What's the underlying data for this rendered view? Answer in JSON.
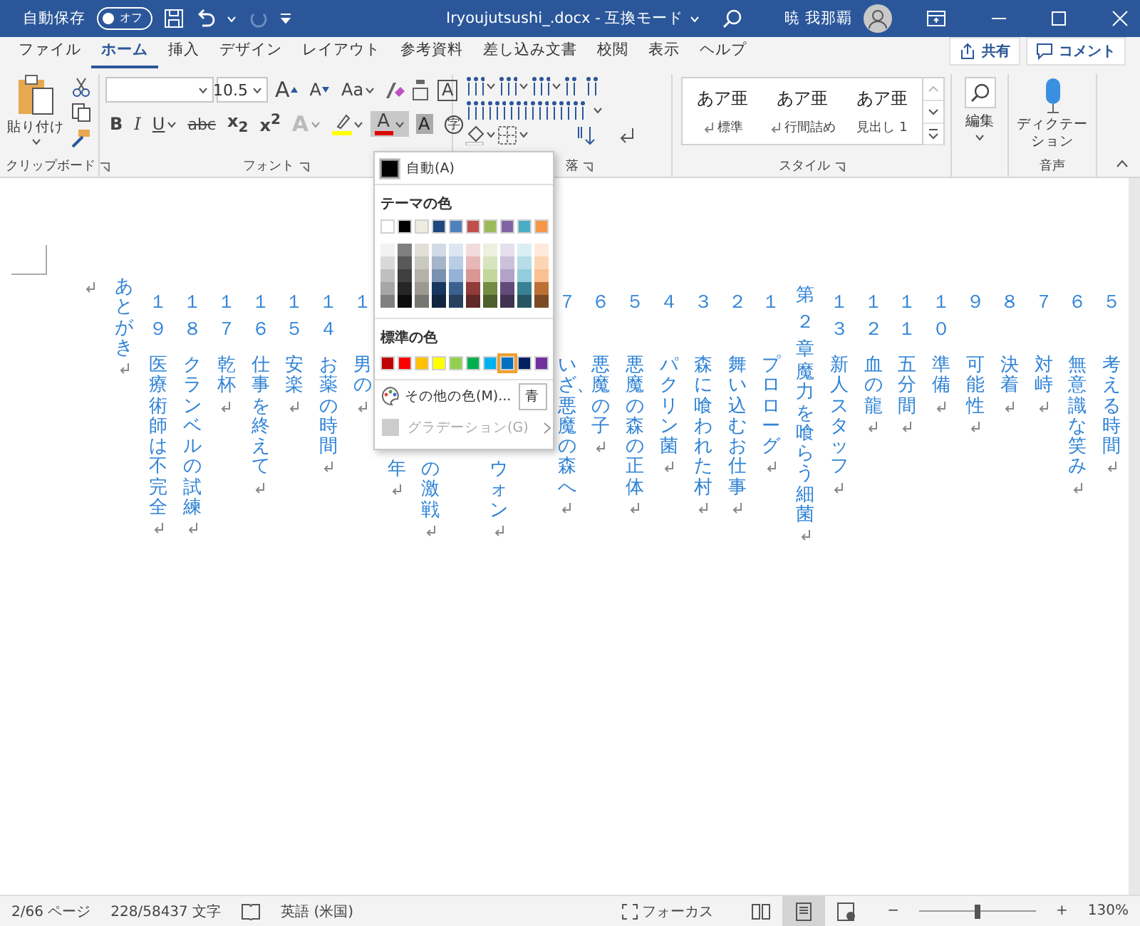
{
  "title_bar": {
    "autosave_label": "自動保存",
    "autosave_toggle": {
      "label": "オフ",
      "on": false
    },
    "document_title": "Iryoujutsushi_.docx  -  互換モード",
    "user_name": "暁 我那覇"
  },
  "tabs": [
    {
      "label": "ファイル",
      "selected": false
    },
    {
      "label": "ホーム",
      "selected": true
    },
    {
      "label": "挿入",
      "selected": false
    },
    {
      "label": "デザイン",
      "selected": false
    },
    {
      "label": "レイアウト",
      "selected": false
    },
    {
      "label": "参考資料",
      "selected": false
    },
    {
      "label": "差し込み文書",
      "selected": false
    },
    {
      "label": "校閲",
      "selected": false
    },
    {
      "label": "表示",
      "selected": false
    },
    {
      "label": "ヘルプ",
      "selected": false
    }
  ],
  "share_button": "共有",
  "comment_button": "コメント",
  "ribbon": {
    "clipboard": {
      "paste_label": "貼り付け",
      "group_label": "クリップボード"
    },
    "font": {
      "font_size": "10.5",
      "group_label": "フォント",
      "row_1": [
        {
          "kind": "grow",
          "label": "A"
        },
        {
          "kind": "shrink",
          "label": "A"
        },
        {
          "kind": "case",
          "label": "Aa"
        },
        {
          "kind": "clear"
        },
        {
          "kind": "ruby"
        },
        {
          "kind": "border",
          "label": "A"
        }
      ],
      "row_2": [
        {
          "kind": "bold",
          "label": "B",
          "pressed": false
        },
        {
          "kind": "italic",
          "label": "I",
          "pressed": false
        },
        {
          "kind": "underline",
          "label": "U",
          "pressed": false
        },
        {
          "kind": "strike",
          "label": "abc",
          "pressed": false
        },
        {
          "kind": "subscript",
          "label": "x$_{2}$",
          "pressed": false
        },
        {
          "kind": "superscript",
          "label": "x$^{2}$",
          "pressed": false
        },
        {
          "kind": "effects",
          "label": "A",
          "pressed": false
        },
        {
          "kind": "highlight",
          "pressed": false
        },
        {
          "kind": "font_color",
          "label": "A",
          "pressed": true
        },
        {
          "kind": "shading",
          "label": "A",
          "pressed": false
        },
        {
          "kind": "enclose",
          "label": "字",
          "pressed": false
        }
      ]
    },
    "paragraph": {
      "group_label": "落"
    },
    "styles": {
      "group_label": "スタイル",
      "items": [
        {
          "sample": "あア亜",
          "name": "標準",
          "mark": true
        },
        {
          "sample": "あア亜",
          "name": "行間詰め",
          "mark": true
        },
        {
          "sample": "あア亜",
          "name": "見出し 1",
          "mark": false
        }
      ]
    },
    "editing": {
      "label": "編集"
    },
    "voice": {
      "label": "ディクテーション",
      "group_label": "音声"
    }
  },
  "document": {
    "columns": [
      {
        "kind": "blank"
      },
      {
        "kind": "plain",
        "title": "あとがき"
      },
      {
        "kind": "numbered",
        "number": "１９",
        "title": "医療術師は不完全"
      },
      {
        "kind": "numbered",
        "number": "１８",
        "title": "クランベルの試練"
      },
      {
        "kind": "numbered",
        "number": "１７",
        "title": "乾杯"
      },
      {
        "kind": "numbered",
        "number": "１６",
        "title": "仕事を終えて"
      },
      {
        "kind": "numbered",
        "number": "１５",
        "title": "安楽"
      },
      {
        "kind": "numbered",
        "number": "１４",
        "title": "お薬の時間"
      },
      {
        "kind": "numbered",
        "number": "１",
        "title": "男の"
      },
      {
        "kind": "covered",
        "title": "年"
      },
      {
        "kind": "covered",
        "title": "の激戦"
      },
      {
        "kind": "covered"
      },
      {
        "kind": "covered",
        "title": "ウォン"
      },
      {
        "kind": "covered"
      },
      {
        "kind": "numbered",
        "number": "７",
        "title": "いざ、悪魔の森へ"
      },
      {
        "kind": "numbered",
        "number": "６",
        "title": "悪魔の子"
      },
      {
        "kind": "numbered",
        "number": "５",
        "title": "悪魔の森の正体"
      },
      {
        "kind": "numbered",
        "number": "４",
        "title": "パクリン菌"
      },
      {
        "kind": "numbered",
        "number": "３",
        "title": "森に喰われた村"
      },
      {
        "kind": "numbered",
        "number": "２",
        "title": "舞い込むお仕事"
      },
      {
        "kind": "numbered",
        "number": "１",
        "title": "プロローグ"
      },
      {
        "kind": "numbered",
        "number": "第２章",
        "title": "魔力を喰らう細菌"
      },
      {
        "kind": "numbered",
        "number": "１３",
        "title": "新人スタッフ"
      },
      {
        "kind": "numbered",
        "number": "１２",
        "title": "血の龍"
      },
      {
        "kind": "numbered",
        "number": "１１",
        "title": "五分間"
      },
      {
        "kind": "numbered",
        "number": "１０",
        "title": "準備"
      },
      {
        "kind": "numbered",
        "number": "９",
        "title": "可能性"
      },
      {
        "kind": "numbered",
        "number": "８",
        "title": "決着"
      },
      {
        "kind": "numbered",
        "number": "７",
        "title": "対峙"
      },
      {
        "kind": "numbered",
        "number": "６",
        "title": "無意識な笑み"
      },
      {
        "kind": "numbered",
        "number": "５",
        "title": "考える時間"
      }
    ]
  },
  "font_color_menu": {
    "automatic": "自動(A)",
    "theme_heading": "テーマの色",
    "theme_colors": [
      {
        "color": "#ffffff"
      },
      {
        "color": "#000000"
      },
      {
        "color": "#eeece1"
      },
      {
        "color": "#1f497d"
      },
      {
        "color": "#4f81bd"
      },
      {
        "color": "#c0504d"
      },
      {
        "color": "#9bbb59"
      },
      {
        "color": "#8064a2"
      },
      {
        "color": "#4bacc6"
      },
      {
        "color": "#f79646"
      }
    ],
    "standard_heading": "標準の色",
    "standard_colors": [
      {
        "color": "#c00000",
        "selected": false
      },
      {
        "color": "#ff0000",
        "selected": false
      },
      {
        "color": "#ffc000",
        "selected": false
      },
      {
        "color": "#ffff00",
        "selected": false
      },
      {
        "color": "#92d050",
        "selected": false
      },
      {
        "color": "#00b050",
        "selected": false
      },
      {
        "color": "#00b0f0",
        "selected": false
      },
      {
        "color": "#0070c0",
        "selected": true
      },
      {
        "color": "#002060",
        "selected": false
      },
      {
        "color": "#7030a0",
        "selected": false
      }
    ],
    "more_colors": "その他の色(M)...",
    "more_colors_tip": "青",
    "gradient": {
      "label": "グラデーション(G)",
      "disabled": true
    }
  },
  "status_bar": {
    "page": "2/66 ページ",
    "words": "228/58437 文字",
    "language": "英語 (米国)",
    "focus": "フォーカス",
    "views": [
      {
        "kind": "read",
        "selected": false
      },
      {
        "kind": "print",
        "selected": true
      },
      {
        "kind": "web",
        "selected": false
      }
    ],
    "zoom": {
      "minus": "−",
      "plus": "+",
      "level": 0.5,
      "value": "130%"
    }
  }
}
